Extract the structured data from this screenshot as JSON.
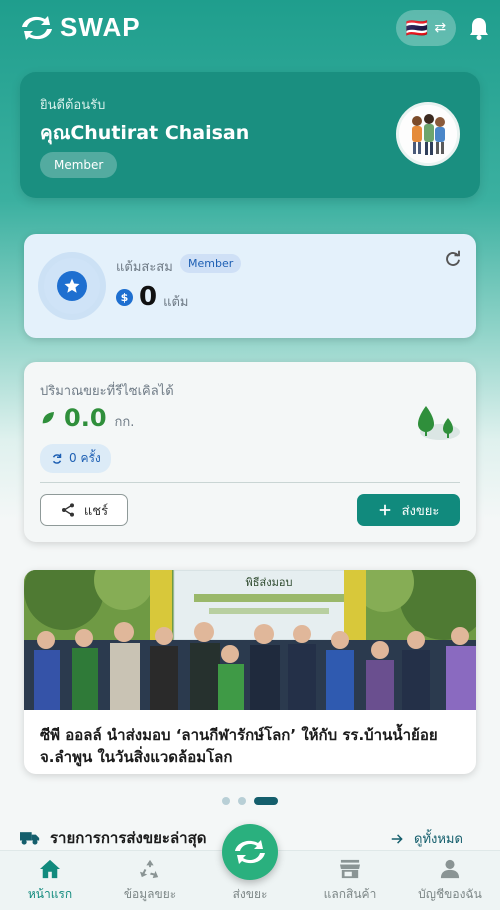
{
  "header": {
    "logo_text": "SWAP",
    "flag": "🇹🇭",
    "swap_arrow": "⇄"
  },
  "welcome": {
    "greeting": "ยินดีต้อนรับ",
    "name": "คุณChutirat Chaisan",
    "role": "Member"
  },
  "points": {
    "label": "แต้มสะสม",
    "badge": "Member",
    "value": "0",
    "unit": "แต้ม",
    "currency_symbol": "$"
  },
  "recycle": {
    "label": "ปริมาณขยะที่รีไซเคิลได้",
    "value": "0.0",
    "unit": "กก.",
    "times": "0 ครั้ง",
    "share_label": "แชร์",
    "send_label": "ส่งขยะ"
  },
  "banner": {
    "caption": "ซีพี ออลล์ นำส่งมอบ ‘ลานกีฬารักษ์โลก’ ให้กับ รร.บ้านน้ำย้อย จ.ลำพูน ในวันสิ่งแวดล้อมโลก",
    "sign_text": "พิธีส่งมอบ",
    "dots_total": 3,
    "dots_active_index": 2
  },
  "recent": {
    "title": "รายการการส่งขยะล่าสุด",
    "view_all": "ดูทั้งหมด"
  },
  "nav": [
    {
      "label": "หน้าแรก",
      "icon": "home-icon",
      "active": true
    },
    {
      "label": "ข้อมูลขยะ",
      "icon": "recycle-icon",
      "active": false
    },
    {
      "label": "ส่งขยะ",
      "icon": "swap-icon",
      "active": false
    },
    {
      "label": "แลกสินค้า",
      "icon": "store-icon",
      "active": false
    },
    {
      "label": "บัญชีของฉัน",
      "icon": "person-icon",
      "active": false
    }
  ],
  "colors": {
    "primary": "#118a7d",
    "blue": "#1e6fd0",
    "green": "#2f8f3b"
  }
}
